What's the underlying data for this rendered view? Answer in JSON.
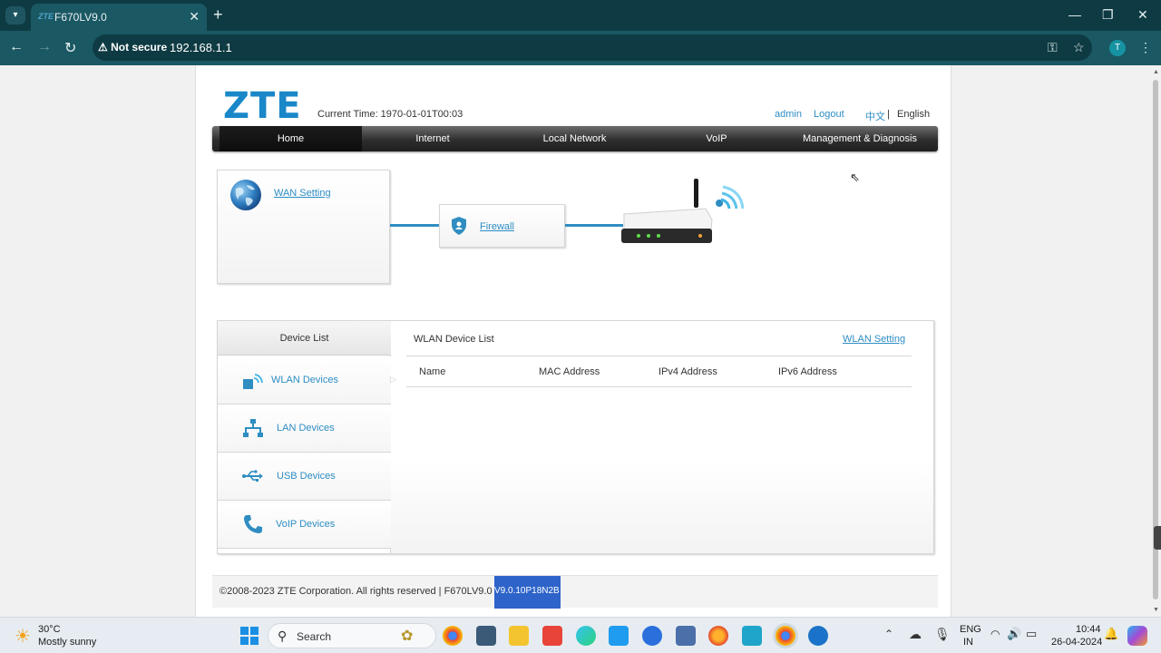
{
  "browser": {
    "tab_title": "F670LV9.0",
    "tab_favicon": "ZTE",
    "security_label": "Not secure",
    "url": "192.168.1.1",
    "profile_initial": "T"
  },
  "header": {
    "logo": "ZTE",
    "current_time_label": "Current Time: 1970-01-01T00:03",
    "user": "admin",
    "logout": "Logout",
    "lang_cn": "中文",
    "lang_sep": "|",
    "lang_en": "English"
  },
  "menu": [
    {
      "label": "Home",
      "active": true
    },
    {
      "label": "Internet",
      "active": false
    },
    {
      "label": "Local Network",
      "active": false
    },
    {
      "label": "VoIP",
      "active": false
    },
    {
      "label": "Management & Diagnosis",
      "active": false
    }
  ],
  "topology": {
    "wan_link": "WAN Setting",
    "firewall_link": "Firewall"
  },
  "device_list": {
    "header": "Device List",
    "items": [
      {
        "label": "WLAN Devices",
        "icon": "wlan-device-icon"
      },
      {
        "label": "LAN Devices",
        "icon": "lan-network-icon"
      },
      {
        "label": "USB Devices",
        "icon": "usb-icon"
      },
      {
        "label": "VoIP Devices",
        "icon": "phone-icon"
      }
    ],
    "panel_title": "WLAN Device List",
    "panel_link": "WLAN Setting",
    "columns": [
      "Name",
      "MAC Address",
      "IPv4 Address",
      "IPv6 Address"
    ]
  },
  "footer": {
    "copyright": "©2008-2023 ZTE Corporation. All rights reserved  |   F670LV9.0",
    "version": "V9.0.10P18N2B"
  },
  "taskbar": {
    "weather_temp": "30°C",
    "weather_desc": "Mostly sunny",
    "search": "Search",
    "lang_top": "ENG",
    "lang_bottom": "IN",
    "time": "10:44",
    "date": "26-04-2024"
  },
  "colors": {
    "accent": "#2d8dc4",
    "browser_dark": "#0e3b43",
    "browser_bar": "#1a5863",
    "selection": "#2e64c9"
  }
}
